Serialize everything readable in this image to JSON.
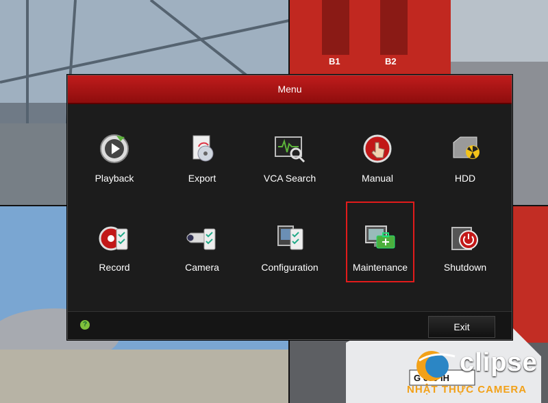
{
  "menu": {
    "title": "Menu",
    "items": [
      {
        "label": "Playback",
        "icon": "playback-icon"
      },
      {
        "label": "Export",
        "icon": "export-icon"
      },
      {
        "label": "VCA Search",
        "icon": "vca-search-icon"
      },
      {
        "label": "Manual",
        "icon": "manual-icon"
      },
      {
        "label": "HDD",
        "icon": "hdd-icon"
      },
      {
        "label": "Record",
        "icon": "record-icon"
      },
      {
        "label": "Camera",
        "icon": "camera-icon"
      },
      {
        "label": "Configuration",
        "icon": "configuration-icon"
      },
      {
        "label": "Maintenance",
        "icon": "maintenance-icon",
        "selected": true
      },
      {
        "label": "Shutdown",
        "icon": "shutdown-icon"
      }
    ],
    "exit_label": "Exit",
    "help_icon": "help-icon"
  },
  "background": {
    "sign_b1": "B1",
    "sign_b2": "B2",
    "plate": "G 689 IH"
  },
  "watermark": {
    "brand": "clipse",
    "sub": "NHẬT THỰC CAMERA"
  },
  "colors": {
    "accent": "#e31b1b",
    "title_bar": "#b51717",
    "panel": "#1c1c1c",
    "text": "#ffffff",
    "help": "#7fbf3c",
    "watermark_orange": "#f2a118"
  }
}
